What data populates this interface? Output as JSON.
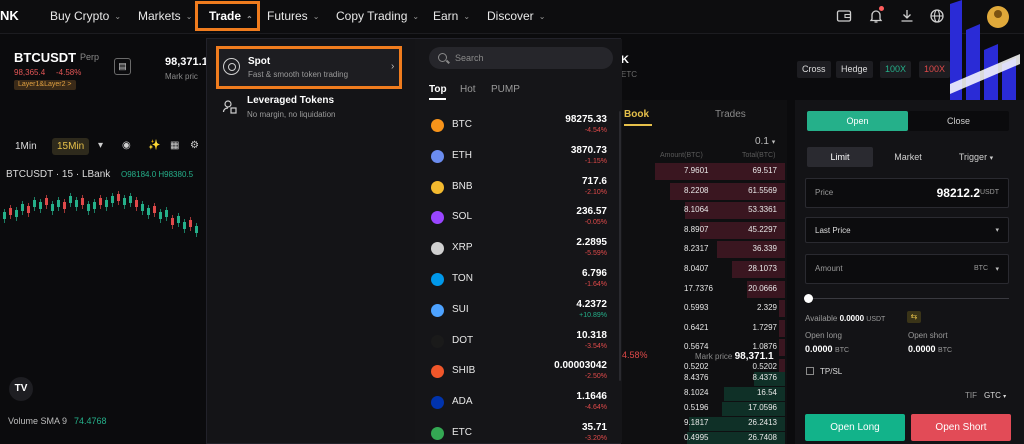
{
  "nav": {
    "logo": "NK",
    "items": [
      {
        "label": "Buy Crypto"
      },
      {
        "label": "Markets"
      },
      {
        "label": "Trade"
      },
      {
        "label": "Futures"
      },
      {
        "label": "Copy Trading"
      },
      {
        "label": "Earn"
      },
      {
        "label": "Discover"
      }
    ],
    "icons": [
      "wallet-icon",
      "bell-icon",
      "download-icon",
      "globe-icon",
      "menu-icon",
      "avatar"
    ]
  },
  "ticker": {
    "symbol": "BTCUSDT",
    "type": "Perp",
    "price": "98,365.4",
    "change": "-4.58%",
    "tag": "Layer1&Layer2 >",
    "last_price": "98,371.1",
    "mark_label": "Mark pric"
  },
  "chart": {
    "timeframes": [
      "1Min",
      "15Min"
    ],
    "active_timeframe": "15Min",
    "title": "BTCUSDT · 15 · LBank",
    "ohlc": "O98184.0 H98380.5",
    "volume_label": "Volume SMA 9",
    "volume_value": "74.4768",
    "tv_logo": "TV"
  },
  "menu": {
    "spot": {
      "title": "Spot",
      "desc": "Fast & smooth token trading"
    },
    "leveraged": {
      "title": "Leveraged Tokens",
      "desc": "No margin, no liquidation"
    },
    "search_placeholder": "Search",
    "tabs": [
      "Top",
      "Hot",
      "PUMP"
    ],
    "active_tab": "Top",
    "coins": [
      {
        "symbol": "BTC",
        "price": "98275.33",
        "change": "-4.54%",
        "dir": "neg",
        "color": "#f7931a"
      },
      {
        "symbol": "ETH",
        "price": "3870.73",
        "change": "-1.15%",
        "dir": "neg",
        "color": "#6b8cef"
      },
      {
        "symbol": "BNB",
        "price": "717.6",
        "change": "-2.10%",
        "dir": "neg",
        "color": "#f3ba2f"
      },
      {
        "symbol": "SOL",
        "price": "236.57",
        "change": "-0.05%",
        "dir": "neg",
        "color": "#9945ff"
      },
      {
        "symbol": "XRP",
        "price": "2.2895",
        "change": "-5.59%",
        "dir": "neg",
        "color": "#d0d0d0"
      },
      {
        "symbol": "TON",
        "price": "6.796",
        "change": "-1.64%",
        "dir": "neg",
        "color": "#0098ea"
      },
      {
        "symbol": "SUI",
        "price": "4.2372",
        "change": "+10.89%",
        "dir": "pos",
        "color": "#4da2ff"
      },
      {
        "symbol": "DOT",
        "price": "10.318",
        "change": "-3.54%",
        "dir": "neg",
        "color": "#1a1a1a"
      },
      {
        "symbol": "SHIB",
        "price": "0.00003042",
        "change": "-2.50%",
        "dir": "neg",
        "color": "#f0562a"
      },
      {
        "symbol": "ADA",
        "price": "1.1646",
        "change": "-4.64%",
        "dir": "neg",
        "color": "#0033ad"
      },
      {
        "symbol": "ETC",
        "price": "35.71",
        "change": "-3.20%",
        "dir": "neg",
        "color": "#34a853"
      }
    ]
  },
  "behind": {
    "frag_etc": "ETC",
    "frag_k": "K"
  },
  "margin": {
    "cross": "Cross",
    "hedge": "Hedge",
    "lev1": "100X",
    "lev2": "100X"
  },
  "book": {
    "tabs": [
      "Book",
      "Trades"
    ],
    "step": "0.1",
    "headers": [
      "Amount(BTC)",
      "Total(BTC)"
    ],
    "asks": [
      {
        "amount": "7.9601",
        "total": "69.517"
      },
      {
        "amount": "8.2208",
        "total": "61.5569"
      },
      {
        "amount": "8.1064",
        "total": "53.3361"
      },
      {
        "amount": "8.8907",
        "total": "45.2297"
      },
      {
        "amount": "8.2317",
        "total": "36.339"
      },
      {
        "amount": "8.0407",
        "total": "28.1073"
      },
      {
        "amount": "17.7376",
        "total": "20.0666"
      },
      {
        "amount": "0.5993",
        "total": "2.329"
      },
      {
        "amount": "0.6421",
        "total": "1.7297"
      },
      {
        "amount": "0.5674",
        "total": "1.0876"
      },
      {
        "amount": "0.5202",
        "total": "0.5202"
      }
    ],
    "mid_change": "4.58%",
    "mark_label": "Mark price",
    "mark_price": "98,371.1",
    "bids": [
      {
        "amount": "8.4376",
        "total": "8.4376"
      },
      {
        "amount": "8.1024",
        "total": "16.54"
      },
      {
        "amount": "0.5196",
        "total": "17.0596"
      },
      {
        "amount": "9.1817",
        "total": "26.2413"
      },
      {
        "amount": "0.4995",
        "total": "26.7408"
      }
    ]
  },
  "panel": {
    "open": "Open",
    "close": "Close",
    "order_types": [
      "Limit",
      "Market",
      "Trigger"
    ],
    "price_label": "Price",
    "price_value": "98212.2",
    "price_unit": "USDT",
    "last_price": "Last Price",
    "amount_label": "Amount",
    "amount_unit": "BTC",
    "available_label": "Available",
    "available_value": "0.0000",
    "available_unit": "USDT",
    "open_long_label": "Open long",
    "open_long_value": "0.0000",
    "open_short_label": "Open short",
    "open_short_value": "0.0000",
    "unit_btc": "BTC",
    "tpsl": "TP/SL",
    "tif": "TIF",
    "gtc": "GTC",
    "btn_long": "Open Long",
    "btn_short": "Open Short"
  }
}
